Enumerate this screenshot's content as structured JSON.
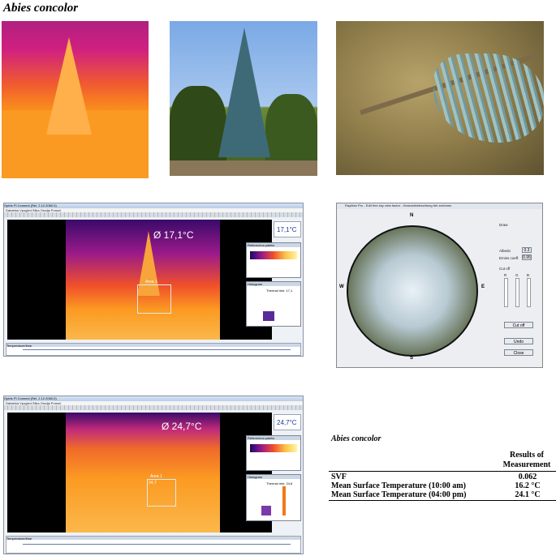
{
  "figure_title": "Abies concolor",
  "screenshot1": {
    "app_title": "Optris PI Connect (Rel. 2.12.2060.0)",
    "menu": "Datoteka  Vpogled  Slika  Orodja  Pomoč",
    "readout": "Ø 17,1°C",
    "area_label": "Area 1",
    "side_value": "17,1°C",
    "panel1_title": "Referenčna paleta",
    "panel2_title": "Histogram",
    "panel2_caption": "Thermal min: 17,1",
    "graph_title": "Temperature/time"
  },
  "screenshot2": {
    "app_title": "Optris PI Connect (Rel. 2.12.2060.0)",
    "menu": "Datoteka  Vpogled  Slika  Orodja  Pomoč",
    "readout": "Ø 24,7°C",
    "area_label": "Area 1",
    "area_value": "24,7",
    "side_value": "24,7°C",
    "panel1_title": "Referenčna paleta",
    "panel2_title": "Histogram",
    "panel2_caption": "Thermal min: 24,6",
    "graph_title": "Temperature/time"
  },
  "fisheye": {
    "app_title": "RayMan Pro - Edit free sky view factor - Horizontbetrachtung frei zeichnen",
    "compass": {
      "n": "N",
      "s": "S",
      "e": "E",
      "w": "W"
    },
    "draw_label": "Draw",
    "albedo_label": "Albedo",
    "albedo_value": "0.3",
    "emiss_label": "Emiss coeff.",
    "emiss_value": "0.95",
    "cutoff_label": "Cut off",
    "rgb": [
      "R",
      "G",
      "B"
    ],
    "cutoff_button": "Cut off",
    "undo_button": "Undo",
    "close_button": "Close"
  },
  "results": {
    "title": "Abies concolor",
    "header_line1": "Results of",
    "header_line2": "Measurement",
    "rows": [
      {
        "label": "SVF",
        "value": "0.062"
      },
      {
        "label": "Mean Surface Temperature (10:00 am)",
        "value": "16.2 °C"
      },
      {
        "label": "Mean Surface Temperature (04:00 pm)",
        "value": "24.1 °C"
      }
    ]
  },
  "colors": {
    "thermal_hot": "#fb9a22",
    "thermal_cold": "#b02080",
    "sky": "#7aa9e6",
    "accent_blue": "#1a3c9a"
  }
}
